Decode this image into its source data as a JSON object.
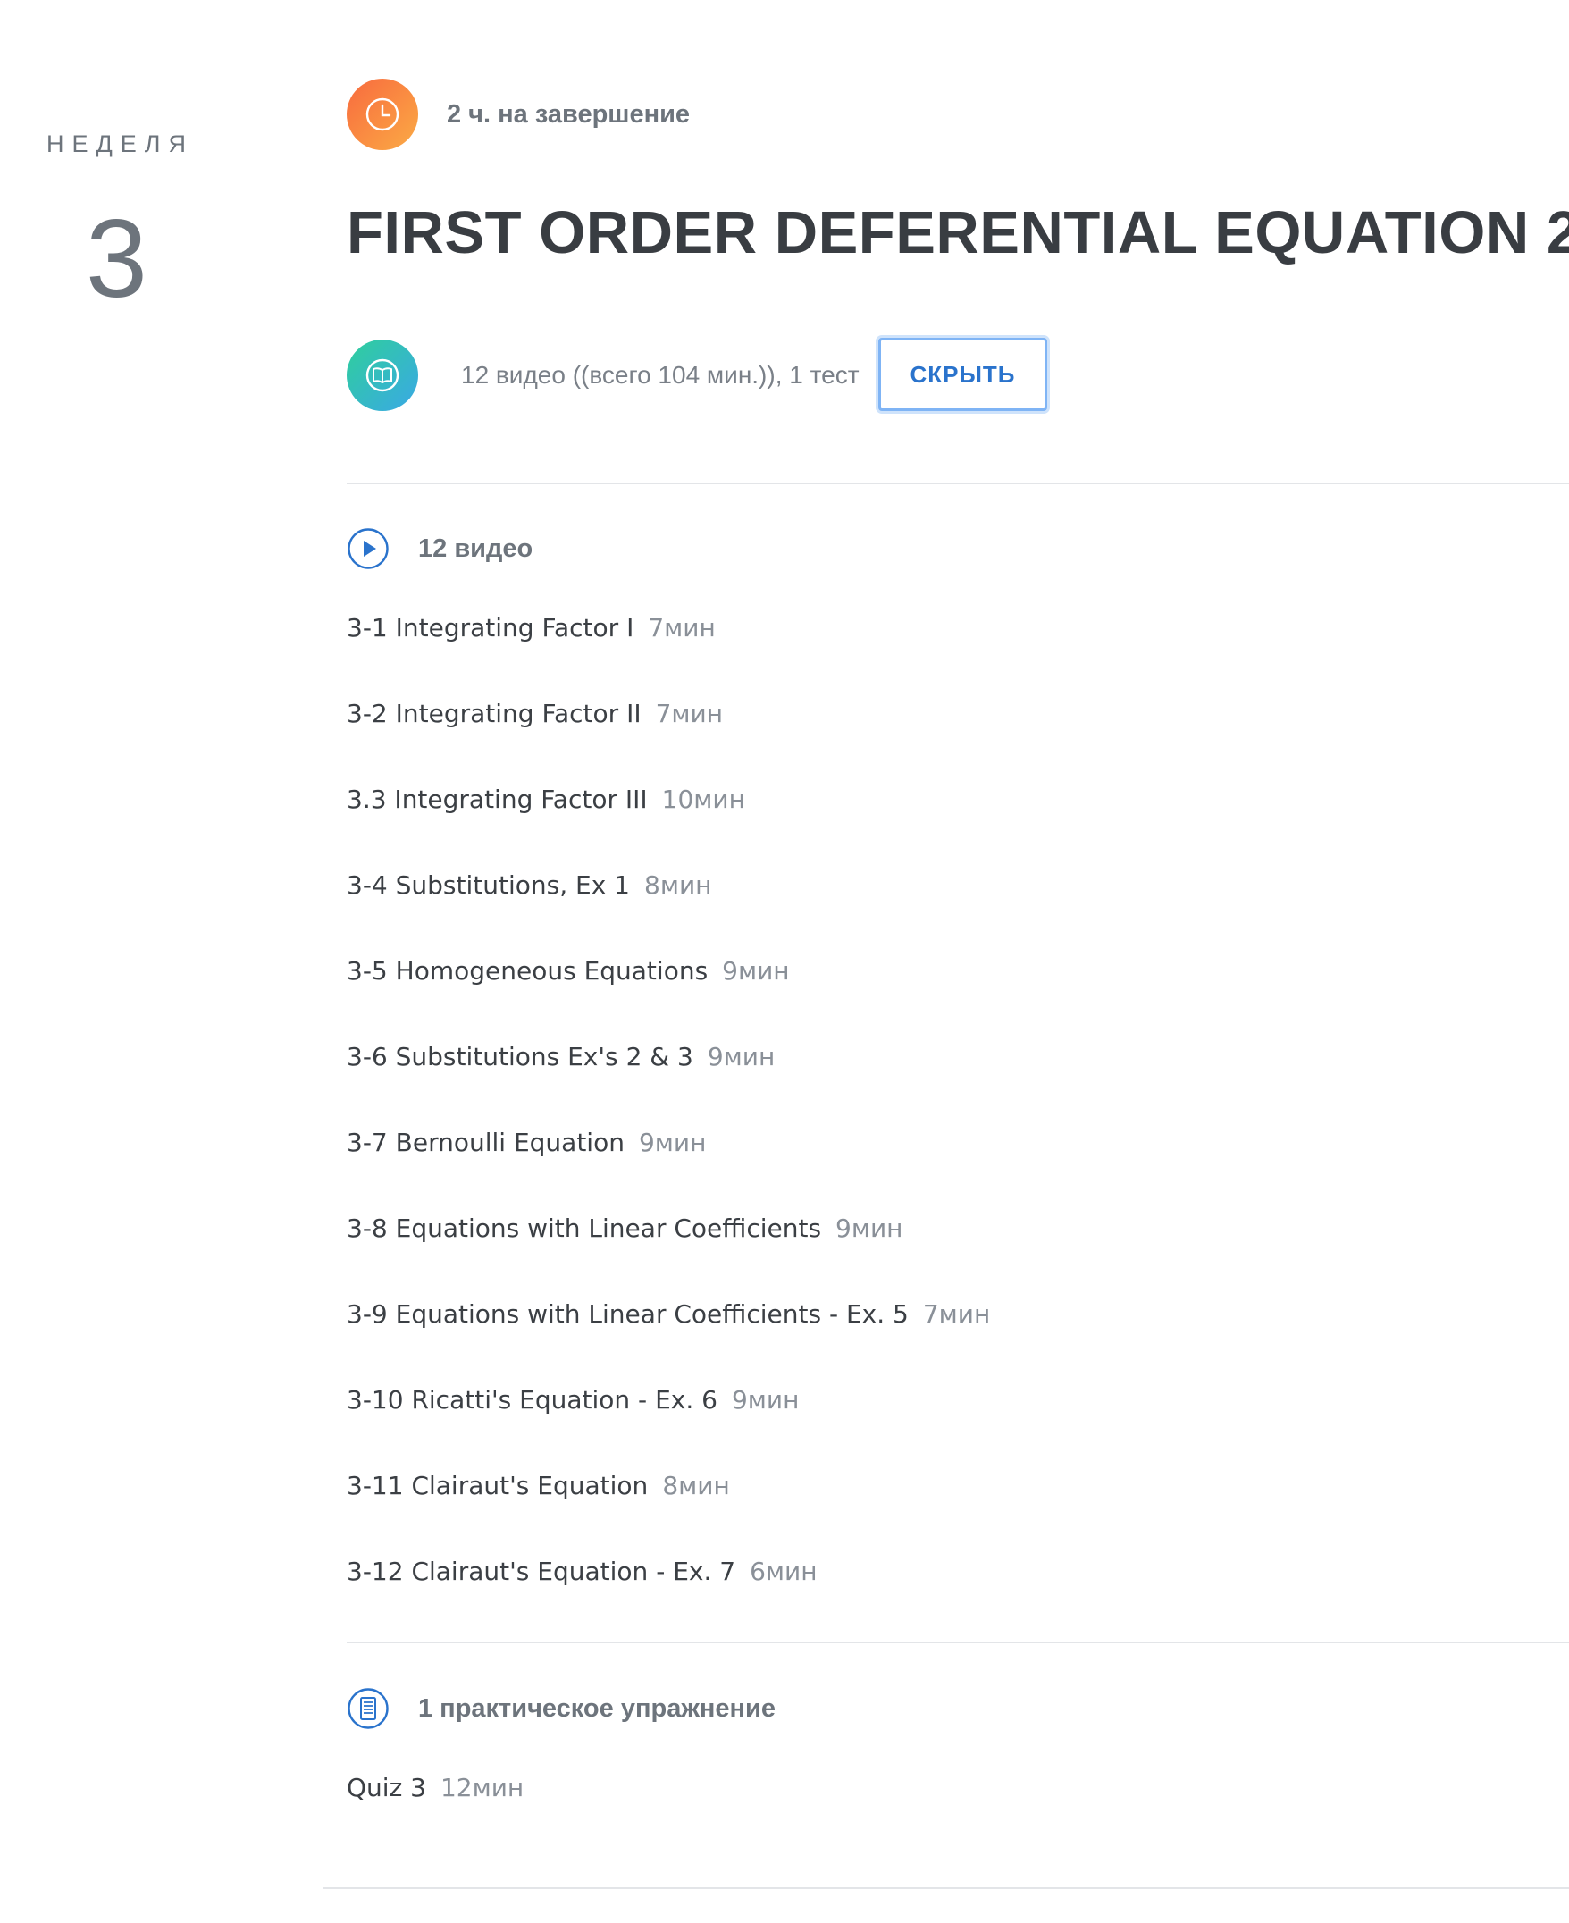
{
  "week": {
    "label": "НЕДЕЛЯ",
    "number": "3"
  },
  "module": {
    "duration": "2 ч. на завершение",
    "title": "FIRST ORDER DEFERENTIAL EQUATION 2",
    "summary": "12 видео ((всего 104 мин.)), 1 тест",
    "hide_button": "СКРЫТЬ"
  },
  "videos": {
    "heading": "12 видео",
    "items": [
      {
        "title": "3-1 Integrating Factor I",
        "time": "7мин"
      },
      {
        "title": "3-2 Integrating Factor II",
        "time": "7мин"
      },
      {
        "title": "3.3 Integrating Factor III",
        "time": "10мин"
      },
      {
        "title": "3-4 Substitutions, Ex 1",
        "time": "8мин"
      },
      {
        "title": "3-5 Homogeneous Equations",
        "time": "9мин"
      },
      {
        "title": "3-6 Substitutions Ex's 2 & 3",
        "time": "9мин"
      },
      {
        "title": "3-7 Bernoulli Equation",
        "time": "9мин"
      },
      {
        "title": "3-8 Equations with Linear Coefficients",
        "time": "9мин"
      },
      {
        "title": "3-9 Equations with Linear Coefficients - Ex. 5",
        "time": "7мин"
      },
      {
        "title": "3-10 Ricatti's Equation - Ex. 6",
        "time": "9мин"
      },
      {
        "title": "3-11 Clairaut's Equation",
        "time": "8мин"
      },
      {
        "title": "3-12 Clairaut's Equation - Ex. 7",
        "time": "6мин"
      }
    ]
  },
  "practice": {
    "heading": "1 практическое упражнение",
    "items": [
      {
        "title": "Quiz 3",
        "time": "12мин"
      }
    ]
  },
  "icons": {
    "clock": "clock-icon",
    "book": "book-icon",
    "play": "play-circle-icon",
    "quiz": "list-document-icon"
  },
  "colors": {
    "accent": "#2a73cc",
    "clock_gradient": [
      "#f86a3e",
      "#fbab45"
    ],
    "book_gradient": [
      "#2fcf9b",
      "#3aa8e6"
    ],
    "title": "#393d42",
    "muted": "#6d747c"
  }
}
